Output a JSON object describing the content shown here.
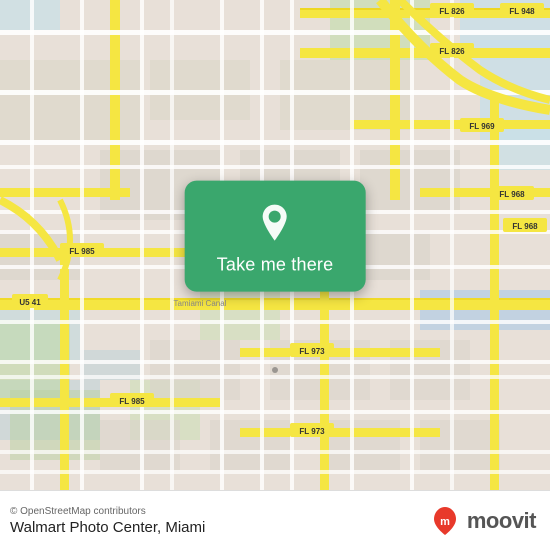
{
  "map": {
    "attribution": "© OpenStreetMap contributors",
    "bg_color": "#e8e0d8",
    "road_yellow": "#f5e642",
    "road_white": "#ffffff",
    "road_blue": "#a8c8e8",
    "road_green": "#b8d8a0"
  },
  "button": {
    "label": "Take me there",
    "icon": "location-pin-icon",
    "bg_color": "#3aa76d"
  },
  "footer": {
    "attribution": "© OpenStreetMap contributors",
    "location_name": "Walmart Photo Center, Miami",
    "brand": "moovit"
  }
}
